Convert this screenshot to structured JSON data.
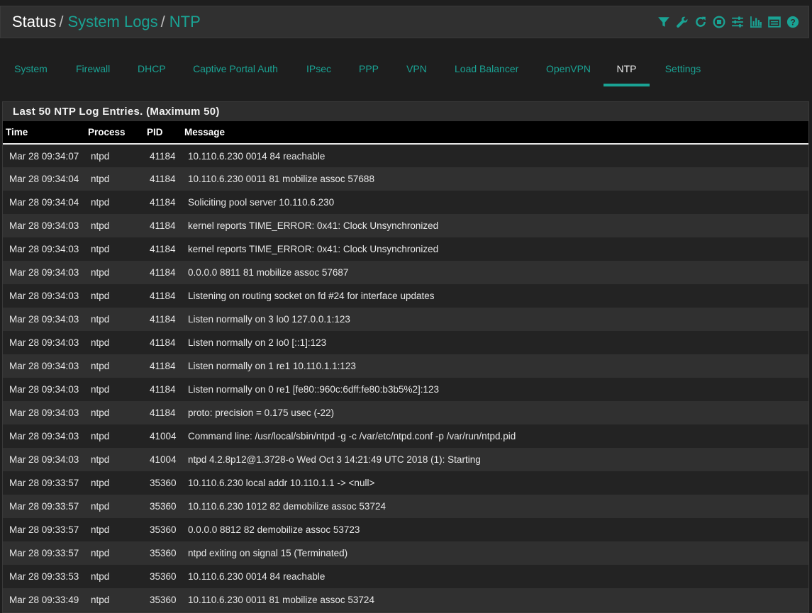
{
  "breadcrumb": {
    "root": "Status",
    "sep1": "/",
    "level2": "System Logs",
    "sep2": "/",
    "current": "NTP"
  },
  "header_icons": [
    "filter-icon",
    "wrench-icon",
    "refresh-icon",
    "stop-icon",
    "sliders-icon",
    "bar-chart-icon",
    "list-icon",
    "help-icon"
  ],
  "accent_color": "#1aa394",
  "tabs": [
    {
      "label": "System"
    },
    {
      "label": "Firewall"
    },
    {
      "label": "DHCP"
    },
    {
      "label": "Captive Portal Auth"
    },
    {
      "label": "IPsec"
    },
    {
      "label": "PPP"
    },
    {
      "label": "VPN"
    },
    {
      "label": "Load Balancer"
    },
    {
      "label": "OpenVPN"
    },
    {
      "label": "NTP",
      "active": true
    },
    {
      "label": "Settings"
    }
  ],
  "panel": {
    "title": "Last 50 NTP Log Entries. (Maximum 50)"
  },
  "table": {
    "columns": [
      "Time",
      "Process",
      "PID",
      "Message"
    ],
    "rows": [
      [
        "Mar 28 09:34:07",
        "ntpd",
        "41184",
        "10.110.6.230 0014 84 reachable"
      ],
      [
        "Mar 28 09:34:04",
        "ntpd",
        "41184",
        "10.110.6.230 0011 81 mobilize assoc 57688"
      ],
      [
        "Mar 28 09:34:04",
        "ntpd",
        "41184",
        "Soliciting pool server 10.110.6.230"
      ],
      [
        "Mar 28 09:34:03",
        "ntpd",
        "41184",
        "kernel reports TIME_ERROR: 0x41: Clock Unsynchronized"
      ],
      [
        "Mar 28 09:34:03",
        "ntpd",
        "41184",
        "kernel reports TIME_ERROR: 0x41: Clock Unsynchronized"
      ],
      [
        "Mar 28 09:34:03",
        "ntpd",
        "41184",
        "0.0.0.0 8811 81 mobilize assoc 57687"
      ],
      [
        "Mar 28 09:34:03",
        "ntpd",
        "41184",
        "Listening on routing socket on fd #24 for interface updates"
      ],
      [
        "Mar 28 09:34:03",
        "ntpd",
        "41184",
        "Listen normally on 3 lo0 127.0.0.1:123"
      ],
      [
        "Mar 28 09:34:03",
        "ntpd",
        "41184",
        "Listen normally on 2 lo0 [::1]:123"
      ],
      [
        "Mar 28 09:34:03",
        "ntpd",
        "41184",
        "Listen normally on 1 re1 10.110.1.1:123"
      ],
      [
        "Mar 28 09:34:03",
        "ntpd",
        "41184",
        "Listen normally on 0 re1 [fe80::960c:6dff:fe80:b3b5%2]:123"
      ],
      [
        "Mar 28 09:34:03",
        "ntpd",
        "41184",
        "proto: precision = 0.175 usec (-22)"
      ],
      [
        "Mar 28 09:34:03",
        "ntpd",
        "41004",
        "Command line: /usr/local/sbin/ntpd -g -c /var/etc/ntpd.conf -p /var/run/ntpd.pid"
      ],
      [
        "Mar 28 09:34:03",
        "ntpd",
        "41004",
        "ntpd 4.2.8p12@1.3728-o Wed Oct 3 14:21:49 UTC 2018 (1): Starting"
      ],
      [
        "Mar 28 09:33:57",
        "ntpd",
        "35360",
        "10.110.6.230 local addr 10.110.1.1 -> <null>"
      ],
      [
        "Mar 28 09:33:57",
        "ntpd",
        "35360",
        "10.110.6.230 1012 82 demobilize assoc 53724"
      ],
      [
        "Mar 28 09:33:57",
        "ntpd",
        "35360",
        "0.0.0.0 8812 82 demobilize assoc 53723"
      ],
      [
        "Mar 28 09:33:57",
        "ntpd",
        "35360",
        "ntpd exiting on signal 15 (Terminated)"
      ],
      [
        "Mar 28 09:33:53",
        "ntpd",
        "35360",
        "10.110.6.230 0014 84 reachable"
      ],
      [
        "Mar 28 09:33:49",
        "ntpd",
        "35360",
        "10.110.6.230 0011 81 mobilize assoc 53724"
      ]
    ]
  }
}
